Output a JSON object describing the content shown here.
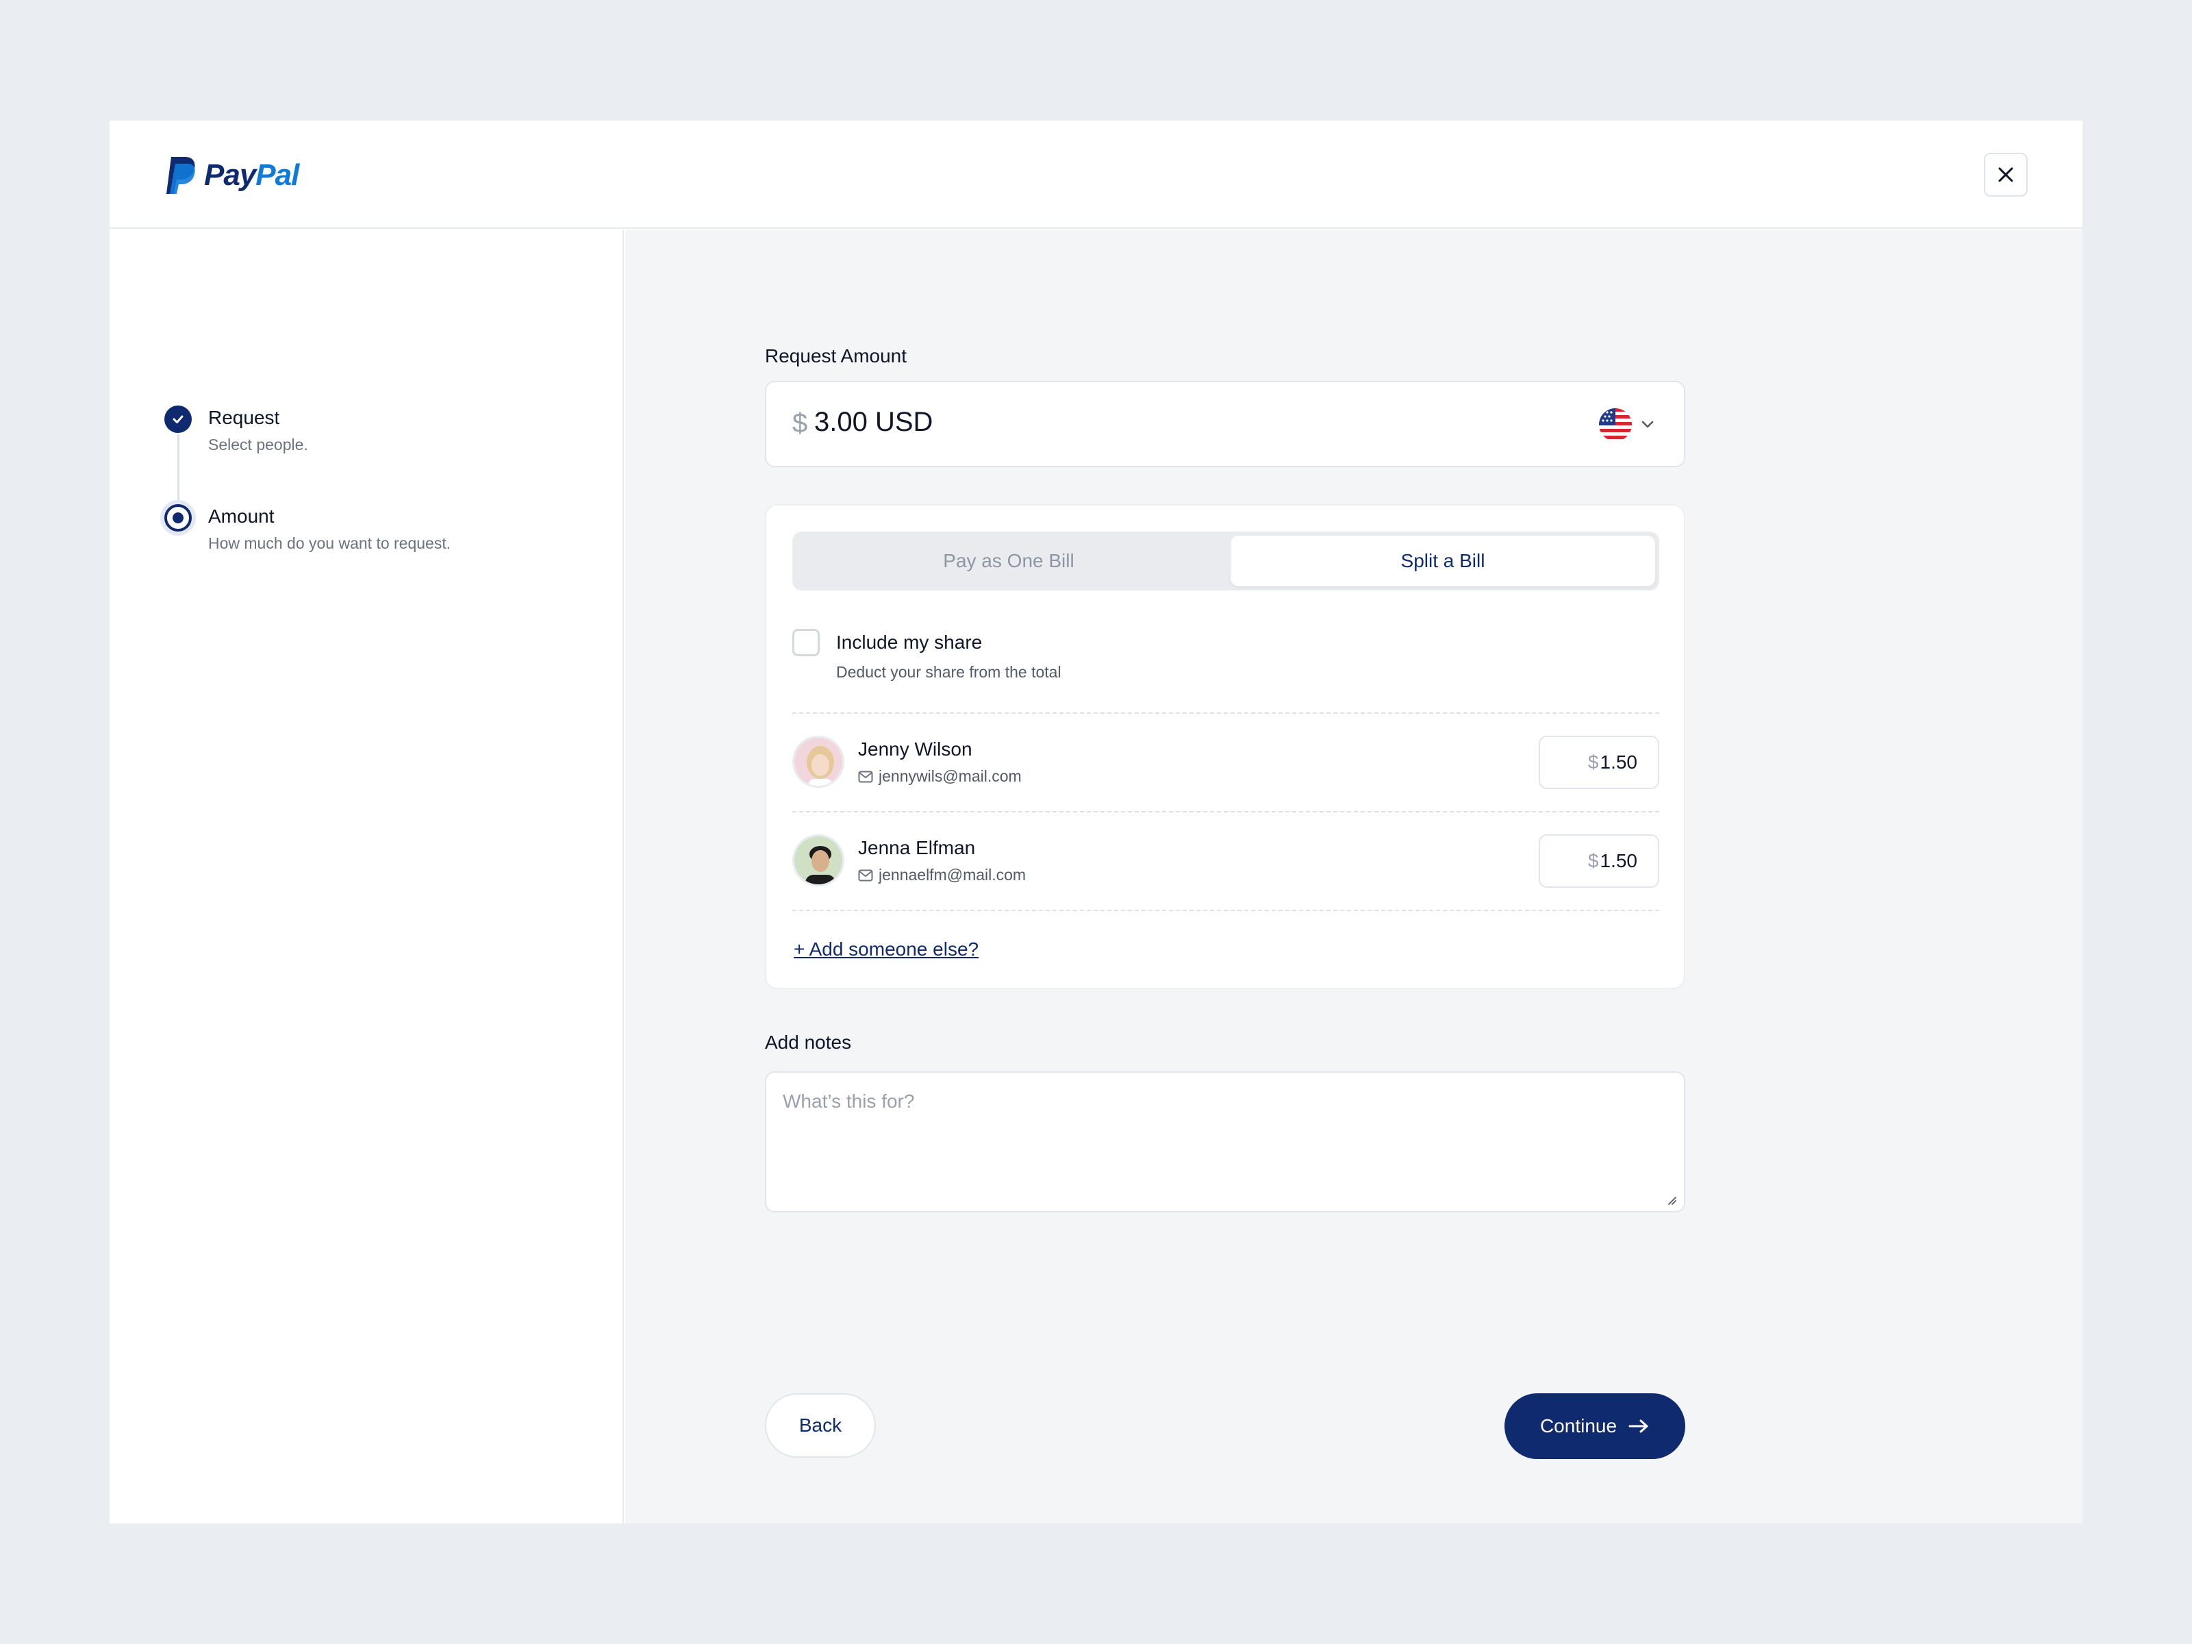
{
  "brand": {
    "logo_pay": "Pay",
    "logo_pal": "Pal"
  },
  "close_icon": "close-icon",
  "steps": [
    {
      "title": "Request",
      "subtitle": "Select people.",
      "state": "done"
    },
    {
      "title": "Amount",
      "subtitle": "How much do you want to request.",
      "state": "active"
    }
  ],
  "request_amount": {
    "label": "Request Amount",
    "currency_symbol": "$",
    "value": "3.00 USD",
    "flag_icon": "us-flag-icon"
  },
  "bill_toggle": {
    "options": [
      "Pay as One Bill",
      "Split a Bill"
    ],
    "selected": "Split a Bill"
  },
  "include_share": {
    "title": "Include my share",
    "subtitle": "Deduct your share from the total",
    "checked": false
  },
  "people": [
    {
      "name": "Jenny Wilson",
      "email": "jennywils@mail.com",
      "currency_symbol": "$",
      "amount": "1.50"
    },
    {
      "name": "Jenna Elfman",
      "email": "jennaelfm@mail.com",
      "currency_symbol": "$",
      "amount": "1.50"
    }
  ],
  "add_someone": "+ Add someone else?",
  "notes": {
    "label": "Add notes",
    "placeholder": "What’s this for?"
  },
  "actions": {
    "back": "Back",
    "continue": "Continue"
  },
  "colors": {
    "brand_navy": "#0f2a6e",
    "brand_blue": "#0f7ad8",
    "background": "#eaedf1"
  }
}
